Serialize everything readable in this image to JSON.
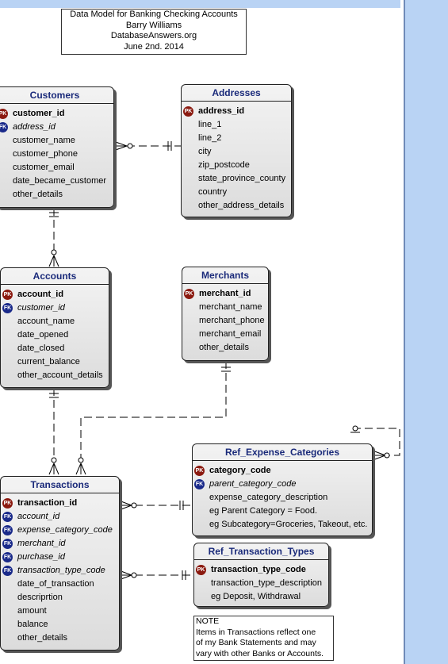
{
  "header": {
    "title": "Data Model for Banking Checking Accounts",
    "author": "Barry Williams",
    "site": "DatabaseAnswers.org",
    "date": "June 2nd. 2014"
  },
  "entities": {
    "customers": {
      "name": "Customers",
      "attributes": [
        {
          "key": "PK",
          "name": "customer_id"
        },
        {
          "key": "FK",
          "name": "address_id"
        },
        {
          "key": "",
          "name": "customer_name"
        },
        {
          "key": "",
          "name": "customer_phone"
        },
        {
          "key": "",
          "name": "customer_email"
        },
        {
          "key": "",
          "name": "date_became_customer"
        },
        {
          "key": "",
          "name": "other_details"
        }
      ]
    },
    "addresses": {
      "name": "Addresses",
      "attributes": [
        {
          "key": "PK",
          "name": "address_id"
        },
        {
          "key": "",
          "name": "line_1"
        },
        {
          "key": "",
          "name": "line_2"
        },
        {
          "key": "",
          "name": "city"
        },
        {
          "key": "",
          "name": "zip_postcode"
        },
        {
          "key": "",
          "name": "state_province_county"
        },
        {
          "key": "",
          "name": "country"
        },
        {
          "key": "",
          "name": "other_address_details"
        }
      ]
    },
    "accounts": {
      "name": "Accounts",
      "attributes": [
        {
          "key": "PK",
          "name": "account_id"
        },
        {
          "key": "FK",
          "name": "customer_id"
        },
        {
          "key": "",
          "name": "account_name"
        },
        {
          "key": "",
          "name": "date_opened"
        },
        {
          "key": "",
          "name": "date_closed"
        },
        {
          "key": "",
          "name": "current_balance"
        },
        {
          "key": "",
          "name": "other_account_details"
        }
      ]
    },
    "merchants": {
      "name": "Merchants",
      "attributes": [
        {
          "key": "PK",
          "name": "merchant_id"
        },
        {
          "key": "",
          "name": "merchant_name"
        },
        {
          "key": "",
          "name": "merchant_phone"
        },
        {
          "key": "",
          "name": "merchant_email"
        },
        {
          "key": "",
          "name": "other_details"
        }
      ]
    },
    "ref_expense_categories": {
      "name": "Ref_Expense_Categories",
      "attributes": [
        {
          "key": "PK",
          "name": "category_code"
        },
        {
          "key": "FK",
          "name": "parent_category_code"
        },
        {
          "key": "",
          "name": "expense_category_description"
        },
        {
          "key": "",
          "name": "eg Parent Category = Food."
        },
        {
          "key": "",
          "name": "eg Subcategory=Groceries, Takeout, etc."
        }
      ]
    },
    "transactions": {
      "name": "Transactions",
      "attributes": [
        {
          "key": "PK",
          "name": "transaction_id"
        },
        {
          "key": "FK",
          "name": "account_id"
        },
        {
          "key": "FK",
          "name": "expense_category_code"
        },
        {
          "key": "FK",
          "name": "merchant_id"
        },
        {
          "key": "FK",
          "name": "purchase_id"
        },
        {
          "key": "FK",
          "name": "transaction_type_code"
        },
        {
          "key": "",
          "name": "date_of_transaction"
        },
        {
          "key": "",
          "name": "descriprtion"
        },
        {
          "key": "",
          "name": "amount"
        },
        {
          "key": "",
          "name": "balance"
        },
        {
          "key": "",
          "name": "other_details"
        }
      ]
    },
    "ref_transaction_types": {
      "name": "Ref_Transaction_Types",
      "attributes": [
        {
          "key": "PK",
          "name": "transaction_type_code"
        },
        {
          "key": "",
          "name": "transaction_type_description"
        },
        {
          "key": "",
          "name": "eg Deposit, Withdrawal"
        }
      ]
    }
  },
  "note": {
    "line1": "NOTE",
    "line2": "Items in Transactions reflect one",
    "line3": "of my Bank Statements and may",
    "line4": "vary with other Banks or Accounts."
  },
  "colors": {
    "pk_badge": "#8b1a10",
    "fk_badge": "#1a2a8a",
    "entity_title": "#1a2a7a",
    "band": "#b9d3f4"
  }
}
